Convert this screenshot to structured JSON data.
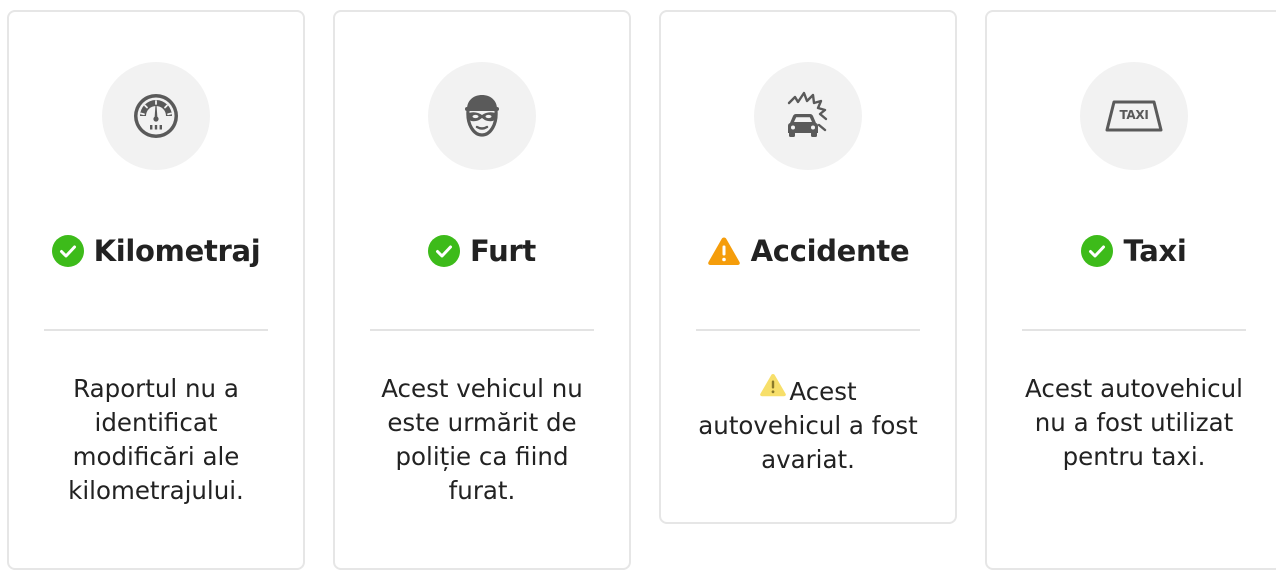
{
  "cards": [
    {
      "icon": "odometer-icon",
      "status": "ok",
      "title": "Kilometraj",
      "description": "Raportul nu a identificat modificări ale kilometrajului."
    },
    {
      "icon": "thief-mask-icon",
      "status": "ok",
      "title": "Furt",
      "description": "Acest vehicul nu este urmărit de poliție ca fiind furat."
    },
    {
      "icon": "car-crash-icon",
      "status": "warning",
      "title": "Accidente",
      "description": "Acest autovehicul a fost avariat."
    },
    {
      "icon": "taxi-sign-icon",
      "icon_text": "TAXI",
      "status": "ok",
      "title": "Taxi",
      "description": "Acest autovehicul nu a fost utilizat pentru taxi."
    }
  ],
  "colors": {
    "ok": "#3dbb1a",
    "warning": "#f59d0b",
    "warning_light": "#f7df6a",
    "icon_gray": "#5a5a5a",
    "circle_bg": "#f2f2f2",
    "divider": "#e3e3e3"
  }
}
